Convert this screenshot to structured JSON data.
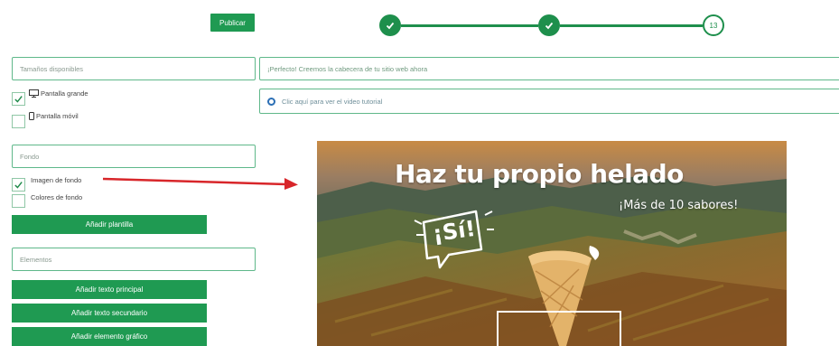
{
  "toolbar": {
    "publish_label": "Publicar"
  },
  "steps": {
    "current_number": "13"
  },
  "left": {
    "sizes_field": "Tamaños disponibles",
    "size_options": [
      {
        "label": "Pantalla grande",
        "checked": true,
        "icon": "monitor-icon"
      },
      {
        "label": "Pantalla móvil",
        "checked": false,
        "icon": "mobile-icon"
      }
    ],
    "background_field": "Fondo",
    "background_options": [
      {
        "label": "Imagen de fondo",
        "checked": true
      },
      {
        "label": "Colores de fondo",
        "checked": false
      }
    ],
    "add_template": "Añadir plantilla",
    "elements_field": "Elementos",
    "element_buttons": [
      "Añadir texto principal",
      "Añadir texto secundario",
      "Añadir elemento gráfico"
    ]
  },
  "right": {
    "message": "¡Perfecto! Creemos la cabecera de tu sitio web ahora",
    "tutorial_link": "Clic aquí para ver el video tutorial"
  },
  "banner": {
    "title": "Haz tu propio helado",
    "subtitle": "¡Más de 10 sabores!",
    "badge": "¡Sí!"
  },
  "colors": {
    "brand_green": "#1f9a52",
    "arrow_red": "#d8262a"
  }
}
